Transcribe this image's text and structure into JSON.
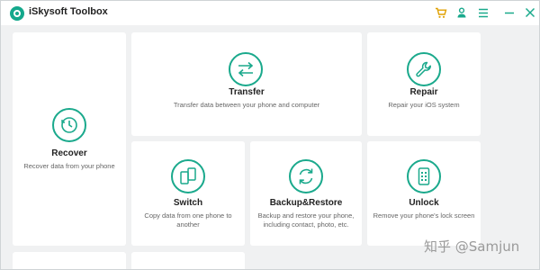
{
  "window": {
    "title": "iSkysoft Toolbox",
    "accent_color": "#1aa98c",
    "cart_color": "#e0a000",
    "controls": [
      "cart-icon",
      "user-icon",
      "menu-icon",
      "minimize-icon",
      "close-icon"
    ]
  },
  "cards": {
    "recover": {
      "title": "Recover",
      "desc": "Recover data from your phone",
      "icon": "clock-icon"
    },
    "transfer": {
      "title": "Transfer",
      "desc": "Transfer data between your phone and computer",
      "icon": "transfer-icon"
    },
    "repair": {
      "title": "Repair",
      "desc": "Repair your iOS system",
      "icon": "wrench-icon"
    },
    "switch": {
      "title": "Switch",
      "desc": "Copy data from one phone to another",
      "icon": "switch-phones-icon"
    },
    "backup": {
      "title": "Backup&Restore",
      "desc": "Backup and restore your phone, including contact, photo, etc.",
      "icon": "backup-restore-icon"
    },
    "unlock": {
      "title": "Unlock",
      "desc": "Remove your phone's lock screen",
      "icon": "unlock-phone-icon"
    }
  },
  "watermark": "知乎 @Samjun"
}
